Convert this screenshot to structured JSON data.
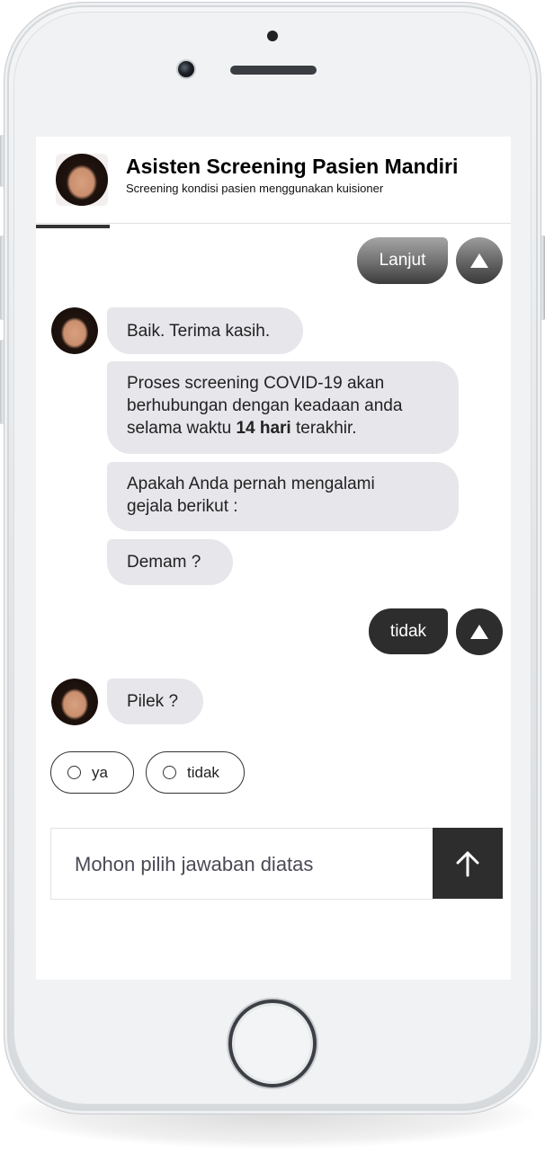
{
  "header": {
    "title": "Asisten Screening Pasien Mandiri",
    "subtitle": "Screening kondisi pasien menggunakan kuisioner"
  },
  "chat": {
    "user_reply_1": "Lanjut",
    "bot_msg_1": "Baik. Terima kasih.",
    "bot_msg_2_line1": "Proses screening COVID-19 akan",
    "bot_msg_2_line2": "berhubungan dengan keadaan anda",
    "bot_msg_2_line3_pre": "selama waktu ",
    "bot_msg_2_line3_bold": "14 hari",
    "bot_msg_2_line3_post": " terakhir.",
    "bot_msg_3_line1": "Apakah Anda pernah mengalami",
    "bot_msg_3_line2": "gejala berikut :",
    "bot_msg_4": "Demam ?",
    "user_reply_2": "tidak",
    "bot_msg_5": "Pilek ?"
  },
  "options": [
    {
      "label": "ya"
    },
    {
      "label": "tidak"
    }
  ],
  "input": {
    "placeholder": "Mohon pilih jawaban diatas"
  },
  "icons": {
    "up": "triangle-up-icon",
    "send": "arrow-up-icon",
    "avatar": "user-avatar-icon"
  },
  "colors": {
    "bot_bubble": "#e6e6eb",
    "user_bubble_dark": "#2d2d2d",
    "send_button": "#2d2d2d"
  }
}
